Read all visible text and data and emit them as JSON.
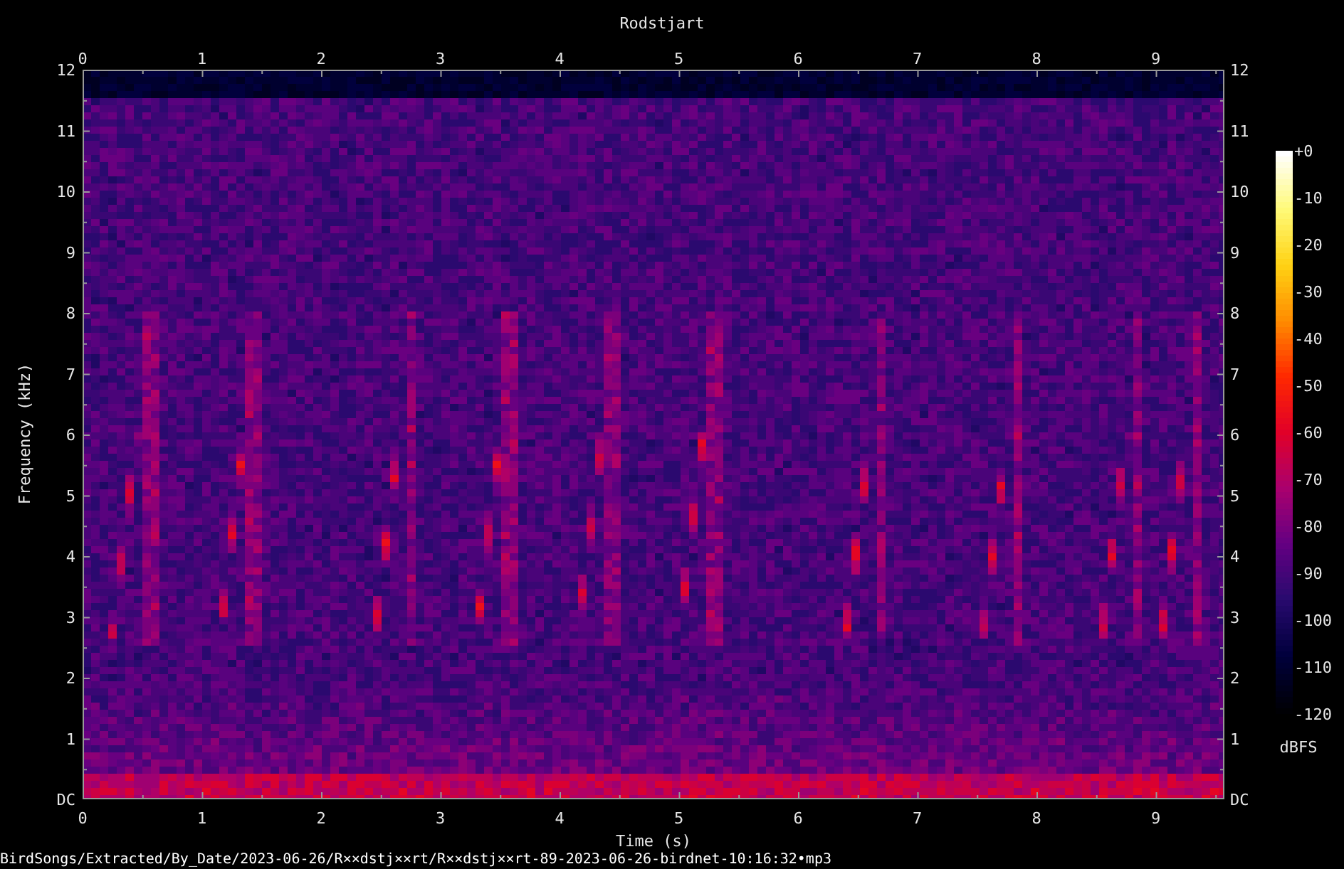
{
  "title": "Rodstjart",
  "x_axis_top": {
    "ticks": [
      "0",
      "1",
      "2",
      "3",
      "4",
      "5",
      "6",
      "7",
      "8",
      "9"
    ]
  },
  "y_axis_left": {
    "label": "Frequency (kHz)",
    "ticks": [
      "12",
      "11",
      "10",
      "9",
      "8",
      "7",
      "6",
      "5",
      "4",
      "3",
      "2",
      "1",
      "DC"
    ]
  },
  "y_axis_right": {
    "ticks": [
      "12",
      "11",
      "10",
      "9",
      "8",
      "7",
      "6",
      "5",
      "4",
      "3",
      "2",
      "1",
      "DC"
    ]
  },
  "x_axis_bottom": {
    "label": "Time (s)",
    "ticks": [
      "0",
      "1",
      "2",
      "3",
      "4",
      "5",
      "6",
      "7",
      "8",
      "9"
    ]
  },
  "colorbar": {
    "label": "dBFS",
    "ticks": [
      "+0",
      "-10",
      "-20",
      "-30",
      "-40",
      "-50",
      "-60",
      "-70",
      "-80",
      "-90",
      "-100",
      "-110",
      "-120"
    ]
  },
  "file_path": "BirdSongs/Extracted/By_Date/2023-06-26/R××dstj××rt/R××dstj××rt-89-2023-06-26-birdnet-10:16:32•mp3"
}
